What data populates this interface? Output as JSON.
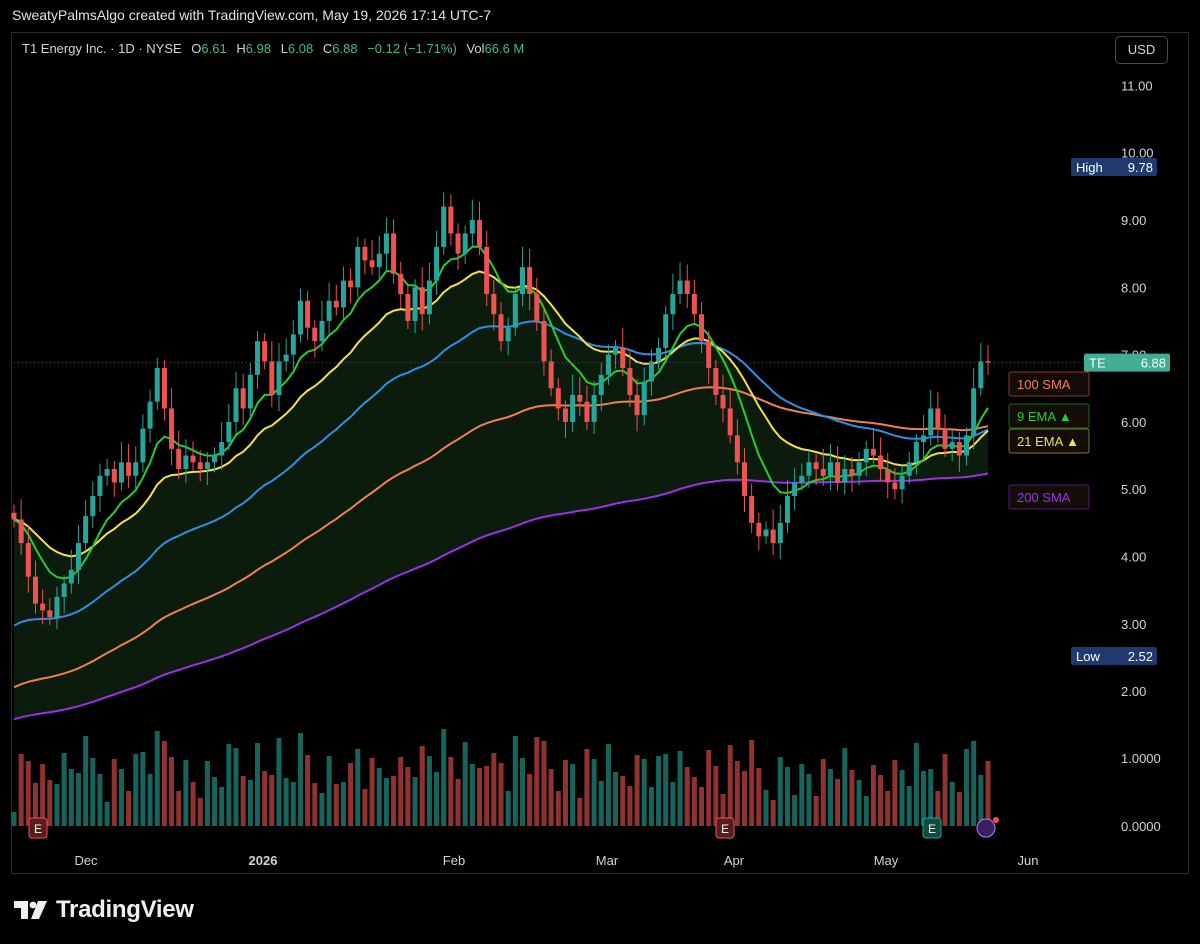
{
  "header": {
    "credit": "SweatyPalmsAlgo created with TradingView.com, May 19, 2026 17:14 UTC-7"
  },
  "legend": {
    "symbol": "T1 Energy Inc. · 1D · NYSE",
    "open_label": "O",
    "open": "6.61",
    "high_label": "H",
    "high": "6.98",
    "low_label": "L",
    "low": "6.08",
    "close_label": "C",
    "close": "6.88",
    "change": "−0.12 (−1.71%)",
    "vol_label": "Vol",
    "vol": "66.6 M"
  },
  "currency_button": "USD",
  "brand": {
    "name": "TradingView",
    "icon": "tradingview-logo-icon"
  },
  "colors": {
    "up": "#26a69a",
    "down": "#ef5350",
    "ema9": "#22d02b",
    "ema21": "#f5e14c",
    "sma50": "#2e8fe6",
    "sma100": "#f0804f",
    "sma200": "#9b30e8",
    "ema_band": "#f2b8b4"
  },
  "chart_data": {
    "type": "candlestick",
    "title": "T1 Energy Inc. · 1D · NYSE",
    "y_ticks": [
      "11.00",
      "10.00",
      "9.00",
      "8.00",
      "7.00",
      "6.00",
      "5.00",
      "4.00",
      "3.00",
      "2.00"
    ],
    "volume_ticks": [
      "1.0000",
      "0.0000"
    ],
    "x_ticks": [
      "Dec",
      "2026",
      "Feb",
      "Mar",
      "Apr",
      "May",
      "Jun"
    ],
    "ylim": [
      1.8,
      11.0
    ],
    "markers": {
      "high": {
        "label": "High",
        "value": "9.78"
      },
      "low": {
        "label": "Low",
        "value": "2.52"
      },
      "last": {
        "label": "TE",
        "value": "6.88"
      }
    },
    "indicator_labels": [
      {
        "name": "100 SMA",
        "value": 6.55,
        "color": "#f0804f"
      },
      {
        "name": "9 EMA ▲",
        "value": 6.06,
        "color": "#22d02b"
      },
      {
        "name": "21 EMA ▲",
        "value": 5.72,
        "color": "#f5e14c"
      },
      {
        "name": "200 SMA",
        "value": 4.88,
        "color": "#9b30e8"
      }
    ],
    "earnings_markers": [
      "E",
      "E",
      "E"
    ],
    "close": [
      4.55,
      4.2,
      3.7,
      3.3,
      3.2,
      3.1,
      3.4,
      3.6,
      3.8,
      4.2,
      4.6,
      4.9,
      5.2,
      5.3,
      5.1,
      5.4,
      5.2,
      5.4,
      5.9,
      6.3,
      6.8,
      6.2,
      5.6,
      5.3,
      5.5,
      5.4,
      5.3,
      5.4,
      5.5,
      5.7,
      6.0,
      6.5,
      6.2,
      6.7,
      7.2,
      6.9,
      6.4,
      6.9,
      7.0,
      7.3,
      7.8,
      7.4,
      7.2,
      7.5,
      7.8,
      7.7,
      8.1,
      8.0,
      8.6,
      8.4,
      8.3,
      8.5,
      8.8,
      8.2,
      7.9,
      7.5,
      8.0,
      7.6,
      8.1,
      8.6,
      9.2,
      8.8,
      8.5,
      8.8,
      9.0,
      8.6,
      7.9,
      7.6,
      7.2,
      7.4,
      7.9,
      8.3,
      7.9,
      7.5,
      6.9,
      6.5,
      6.2,
      6.0,
      6.4,
      6.3,
      6.0,
      6.4,
      6.7,
      7.0,
      7.1,
      6.8,
      6.4,
      6.1,
      6.6,
      6.9,
      7.1,
      7.6,
      7.9,
      8.1,
      7.9,
      7.6,
      7.2,
      6.8,
      6.4,
      6.2,
      5.8,
      5.4,
      4.9,
      4.5,
      4.3,
      4.4,
      4.2,
      4.5,
      4.9,
      5.1,
      5.2,
      5.4,
      5.3,
      5.2,
      5.4,
      5.1,
      5.3,
      5.2,
      5.4,
      5.6,
      5.5,
      5.3,
      5.1,
      5.0,
      5.2,
      5.4,
      5.7,
      5.8,
      6.2,
      5.9,
      5.6,
      5.7,
      5.5,
      5.8,
      6.5,
      6.9,
      6.88
    ],
    "ema9_last": 6.06,
    "ema21_last": 5.72,
    "sma50_last": 5.72,
    "sma100_last": 6.55,
    "sma200_last": 4.88
  }
}
